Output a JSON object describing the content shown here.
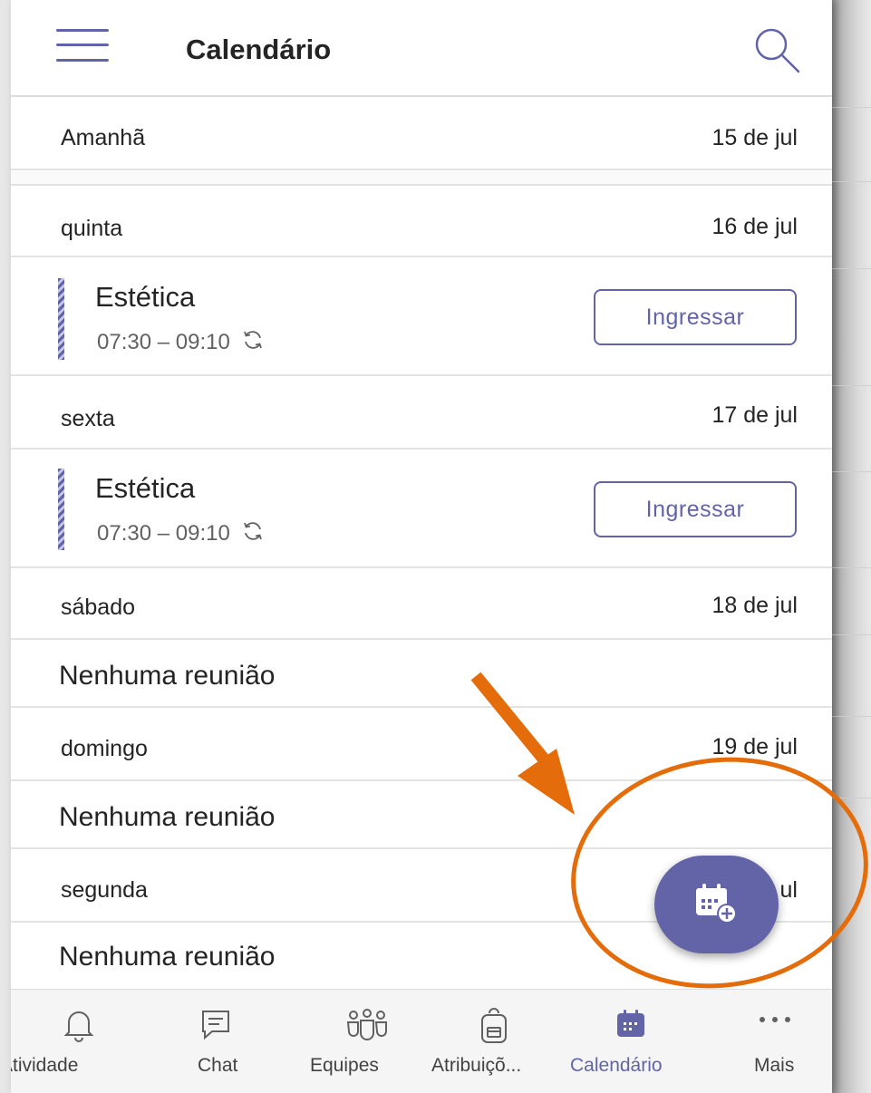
{
  "header": {
    "title": "Calendário",
    "menu_icon": "hamburger-menu-icon",
    "search_icon": "search-icon"
  },
  "days": [
    {
      "label": "Amanhã",
      "date": "15 de jul"
    },
    {
      "label": "quinta",
      "date": "16 de jul"
    },
    {
      "label": "sexta",
      "date": "17 de jul"
    },
    {
      "label": "sábado",
      "date": "18 de jul"
    },
    {
      "label": "domingo",
      "date": "19 de jul"
    },
    {
      "label": "segunda",
      "date": "ul"
    }
  ],
  "events": [
    {
      "title": "Estética",
      "time": "07:30 – 09:10",
      "button": "Ingressar",
      "recurring_icon": "sync-icon"
    },
    {
      "title": "Estética",
      "time": "07:30 – 09:10",
      "button": "Ingressar",
      "recurring_icon": "sync-icon"
    }
  ],
  "empty_text": [
    "Nenhuma reunião",
    "Nenhuma reunião",
    "Nenhuma reunião"
  ],
  "fab": {
    "icon": "new-meeting-calendar-icon",
    "color": "#6264a7"
  },
  "nav": [
    {
      "label": "Atividade",
      "icon": "bell-icon"
    },
    {
      "label": "Chat",
      "icon": "chat-icon"
    },
    {
      "label": "Equipes",
      "icon": "teams-icon"
    },
    {
      "label": "Atribuiçõ...",
      "icon": "backpack-icon"
    },
    {
      "label": "Calendário",
      "icon": "calendar-icon",
      "active": true
    },
    {
      "label": "Mais",
      "icon": "more-icon"
    }
  ],
  "colors": {
    "accent": "#6264a7",
    "annotation": "#e46c0a"
  }
}
